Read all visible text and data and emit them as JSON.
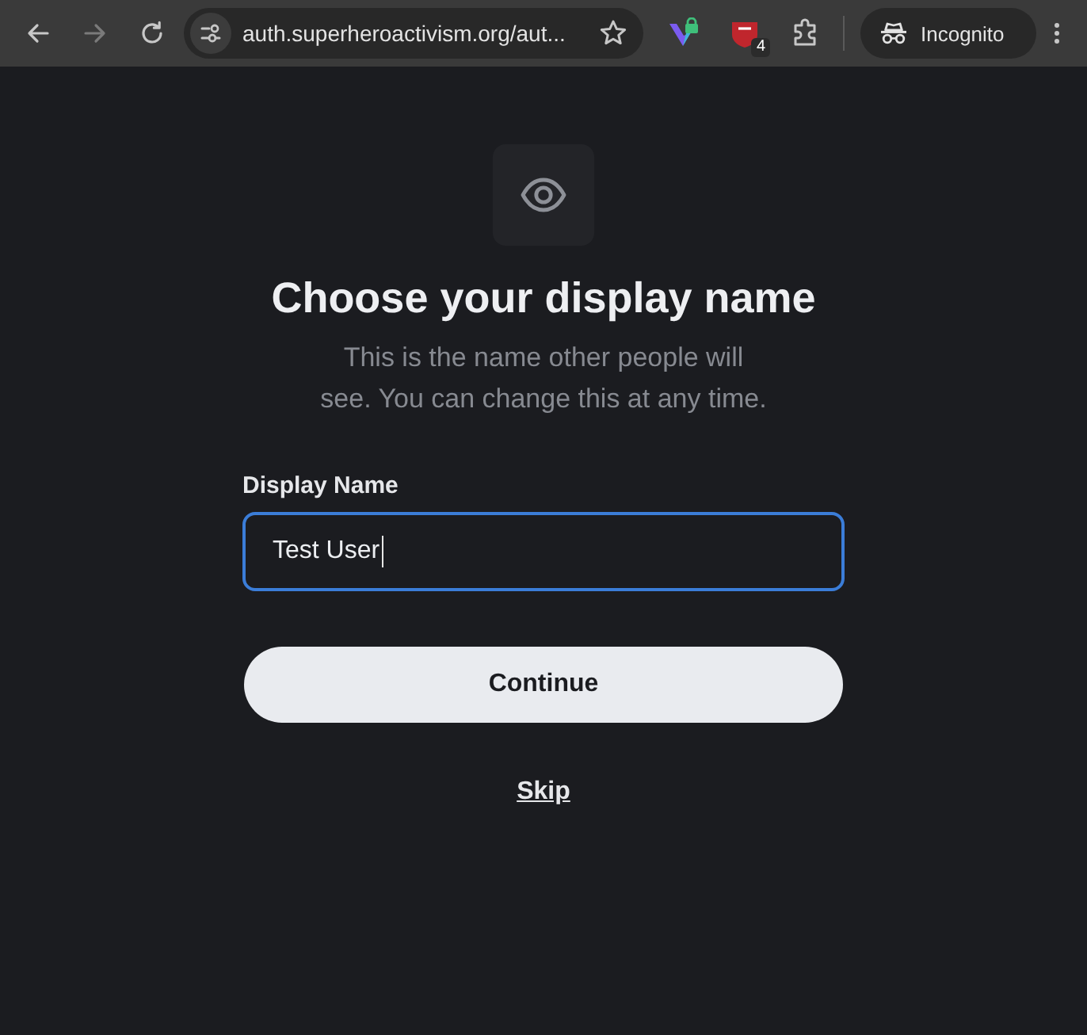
{
  "browser": {
    "nav_buttons": [
      {
        "kind": "back",
        "disabled": false
      },
      {
        "kind": "forward",
        "disabled": true
      },
      {
        "kind": "reload",
        "disabled": false
      }
    ],
    "address_bar": {
      "url": "auth.superheroactivism.org/aut..."
    },
    "extensions": [
      {
        "kind": "v-lock"
      },
      {
        "kind": "shield",
        "badge": "4"
      },
      {
        "kind": "puzzle"
      }
    ],
    "profile": {
      "label": "Incognito"
    }
  },
  "page": {
    "title": "Choose your display name",
    "subtitle": "This is the name other people will see. You can change this at any time.",
    "field": {
      "label": "Display Name",
      "value": "Test User",
      "focused": true
    },
    "primary_button": "Continue",
    "skip_link": "Skip"
  }
}
